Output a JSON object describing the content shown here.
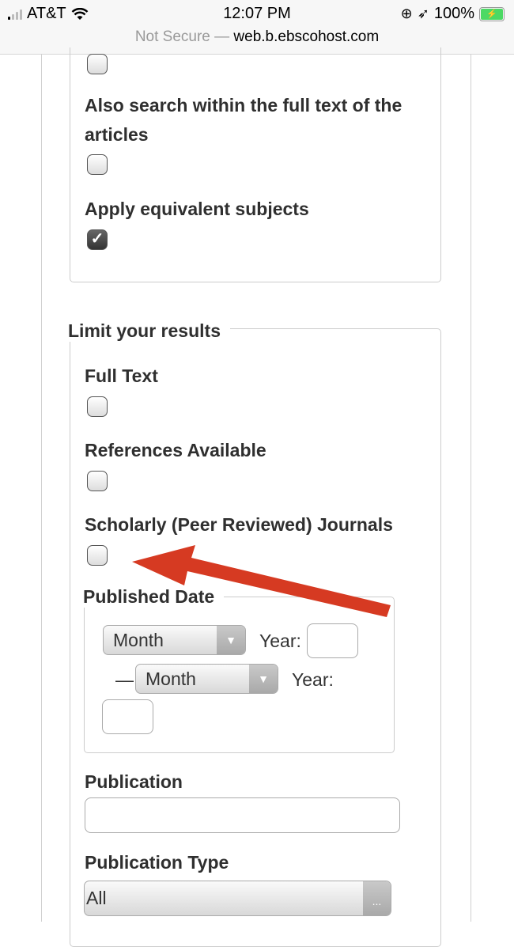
{
  "status_bar": {
    "carrier": "AT&T",
    "time": "12:07 PM",
    "battery": "100%",
    "icons": [
      "signal-icon",
      "wifi-icon",
      "orientation-lock-icon",
      "location-icon",
      "battery-charging-icon"
    ]
  },
  "browser": {
    "security": "Not Secure",
    "separator": "—",
    "domain": "web.b.ebscohost.com"
  },
  "search_options": {
    "items": [
      {
        "label": "",
        "checked": false
      },
      {
        "label": "Also search within the full text of the articles",
        "checked": false
      },
      {
        "label": "Apply equivalent subjects",
        "checked": true
      }
    ]
  },
  "limit_results": {
    "legend": "Limit your results",
    "checkboxes": [
      {
        "label": "Full Text",
        "checked": false
      },
      {
        "label": "References Available",
        "checked": false
      },
      {
        "label": "Scholarly (Peer Reviewed) Journals",
        "checked": false
      }
    ],
    "published_date": {
      "legend": "Published Date",
      "from_month": "Month",
      "year_label": "Year:",
      "to_separator": "—",
      "to_month": "Month",
      "from_year_value": "",
      "to_year_value": ""
    },
    "publication": {
      "label": "Publication",
      "value": ""
    },
    "publication_type": {
      "label": "Publication Type",
      "value": "All",
      "button": "..."
    }
  },
  "annotation": {
    "type": "arrow",
    "color": "#d63a22",
    "points_to": "Scholarly (Peer Reviewed) Journals checkbox"
  }
}
